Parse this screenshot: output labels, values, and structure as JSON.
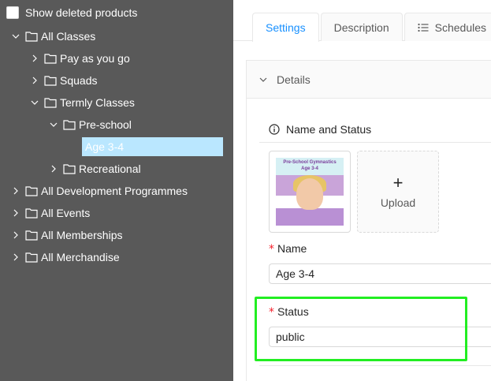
{
  "sidebar": {
    "show_deleted_label": "Show deleted products",
    "tree": [
      {
        "label": "All Classes",
        "expanded": true
      },
      {
        "label": "Pay as you go",
        "expanded": false
      },
      {
        "label": "Squads",
        "expanded": false
      },
      {
        "label": "Termly Classes",
        "expanded": true
      },
      {
        "label": "Pre-school",
        "expanded": true
      },
      {
        "label": "Age 3-4",
        "selected": true
      },
      {
        "label": "Recreational",
        "expanded": false
      },
      {
        "label": "All Development Programmes",
        "expanded": false
      },
      {
        "label": "All Events",
        "expanded": false
      },
      {
        "label": "All Memberships",
        "expanded": false
      },
      {
        "label": "All Merchandise",
        "expanded": false
      }
    ]
  },
  "tabs": [
    {
      "label": "Settings",
      "active": true
    },
    {
      "label": "Description",
      "active": false
    },
    {
      "label": "Schedules",
      "active": false,
      "icon": "list-icon"
    }
  ],
  "panel": {
    "header": "Details",
    "section_title": "Name  and Status",
    "thumbnail": {
      "caption_line1": "Pre-School Gymnastics",
      "caption_line2": "Age 3-4"
    },
    "upload_label": "Upload",
    "upload_symbol": "+",
    "required_mark": "*",
    "name_label": "Name",
    "name_value": "Age 3-4",
    "status_label": "Status",
    "status_value": "public"
  },
  "colors": {
    "sidebar_bg": "#595959",
    "accent": "#1890ff",
    "selected_bg": "#bae7ff",
    "highlight": "#22ee22",
    "required": "#f5222d"
  }
}
